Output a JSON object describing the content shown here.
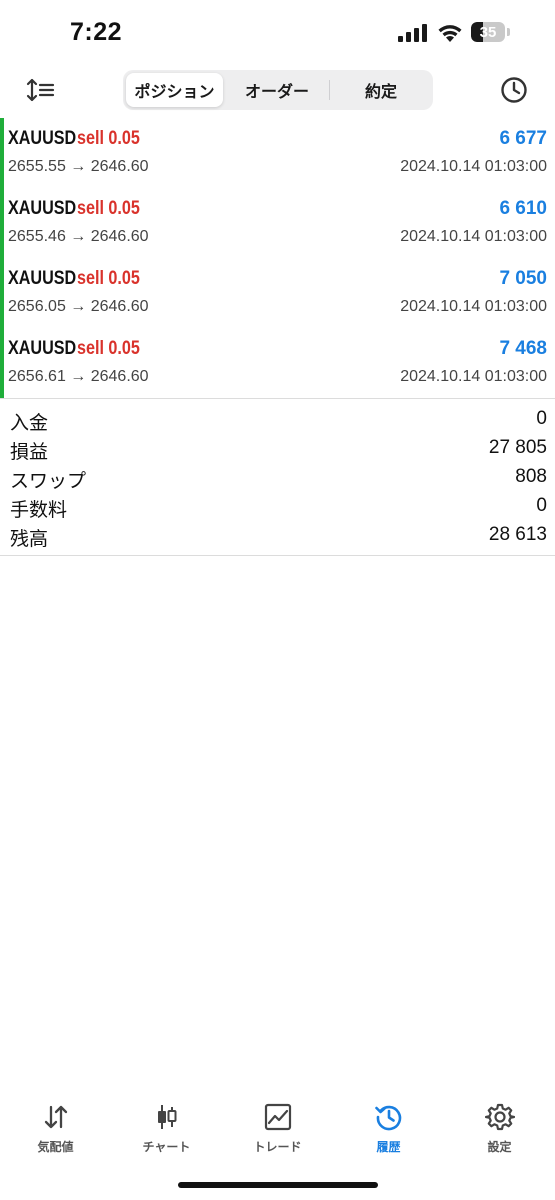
{
  "status_bar": {
    "time": "7:22",
    "battery": "35"
  },
  "toolbar": {
    "tabs": [
      {
        "label": "ポジション",
        "active": true
      },
      {
        "label": "オーダー",
        "active": false
      },
      {
        "label": "約定",
        "active": false
      }
    ]
  },
  "trades": [
    {
      "symbol": "XAUUSD",
      "side": "sell 0.05",
      "profit": "6 677",
      "prices": "2655.55 → 2646.60",
      "time": "2024.10.14 01:03:00"
    },
    {
      "symbol": "XAUUSD",
      "side": "sell 0.05",
      "profit": "6 610",
      "prices": "2655.46 → 2646.60",
      "time": "2024.10.14 01:03:00"
    },
    {
      "symbol": "XAUUSD",
      "side": "sell 0.05",
      "profit": "7 050",
      "prices": "2656.05 → 2646.60",
      "time": "2024.10.14 01:03:00"
    },
    {
      "symbol": "XAUUSD",
      "side": "sell 0.05",
      "profit": "7 468",
      "prices": "2656.61 → 2646.60",
      "time": "2024.10.14 01:03:00"
    }
  ],
  "summary": [
    {
      "label": "入金",
      "value": "0"
    },
    {
      "label": "損益",
      "value": "27 805"
    },
    {
      "label": "スワップ",
      "value": "808"
    },
    {
      "label": "手数料",
      "value": "0"
    },
    {
      "label": "残高",
      "value": "28 613"
    }
  ],
  "bottom_nav": [
    {
      "label": "気配値",
      "icon": "quotes-arrows-icon",
      "active": false
    },
    {
      "label": "チャート",
      "icon": "candlestick-chart-icon",
      "active": false
    },
    {
      "label": "トレード",
      "icon": "trade-line-chart-icon",
      "active": false
    },
    {
      "label": "履歴",
      "icon": "history-clock-icon",
      "active": true
    },
    {
      "label": "設定",
      "icon": "gear-icon",
      "active": false
    }
  ],
  "colors": {
    "accent": "#1a7fe0",
    "sell": "#d9322b",
    "position_marker": "#1fae3a"
  }
}
